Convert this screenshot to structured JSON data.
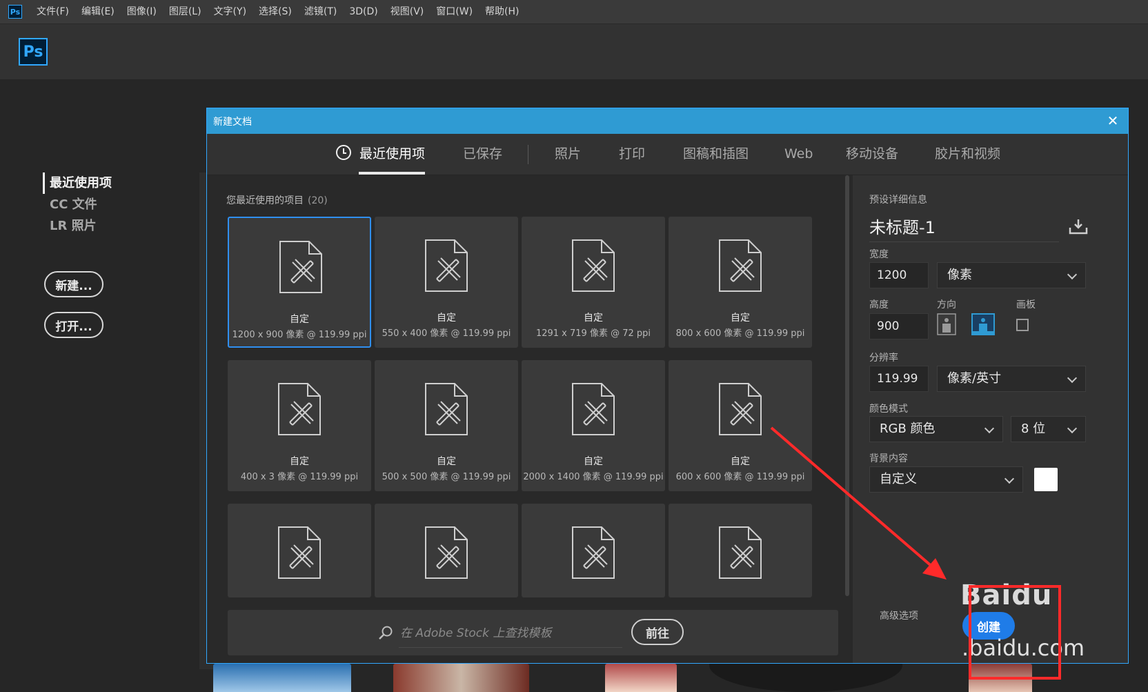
{
  "menubar": {
    "app_icon": "Ps",
    "items": [
      "文件(F)",
      "编辑(E)",
      "图像(I)",
      "图层(L)",
      "文字(Y)",
      "选择(S)",
      "滤镜(T)",
      "3D(D)",
      "视图(V)",
      "窗口(W)",
      "帮助(H)"
    ]
  },
  "appbar": {
    "logo": "Ps"
  },
  "home": {
    "nav": [
      "最近使用项",
      "CC 文件",
      "LR 照片"
    ],
    "new_button": "新建...",
    "open_button": "打开..."
  },
  "dialog": {
    "title": "新建文档",
    "tabs": [
      "最近使用项",
      "已保存",
      "照片",
      "打印",
      "图稿和插图",
      "Web",
      "移动设备",
      "胶片和视频"
    ],
    "recent_heading": "您最近使用的项目",
    "recent_count": "(20)",
    "cards": [
      {
        "name": "自定",
        "meta": "1200 x 900 像素 @ 119.99 ppi"
      },
      {
        "name": "自定",
        "meta": "550 x 400 像素 @ 119.99 ppi"
      },
      {
        "name": "自定",
        "meta": "1291 x 719 像素 @ 72 ppi"
      },
      {
        "name": "自定",
        "meta": "800 x 600 像素 @ 119.99 ppi"
      },
      {
        "name": "自定",
        "meta": "400 x 3 像素 @ 119.99 ppi"
      },
      {
        "name": "自定",
        "meta": "500 x 500 像素 @ 119.99 ppi"
      },
      {
        "name": "自定",
        "meta": "2000 x 1400 像素 @ 119.99 ppi"
      },
      {
        "name": "自定",
        "meta": "600 x 600 像素 @ 119.99 ppi"
      },
      {
        "name": "",
        "meta": ""
      },
      {
        "name": "",
        "meta": ""
      },
      {
        "name": "",
        "meta": ""
      },
      {
        "name": "",
        "meta": ""
      }
    ],
    "stock_placeholder": "在 Adobe Stock 上查找模板",
    "go_button": "前往",
    "preset": {
      "heading": "预设详细信息",
      "doc_name": "未标题-1",
      "width_label": "宽度",
      "width_value": "1200",
      "width_unit": "像素",
      "height_label": "高度",
      "height_value": "900",
      "orientation_label": "方向",
      "artboard_label": "画板",
      "resolution_label": "分辨率",
      "resolution_value": "119.99",
      "resolution_unit": "像素/英寸",
      "color_mode_label": "颜色模式",
      "color_mode": "RGB 颜色",
      "bit_depth": "8 位",
      "background_label": "背景内容",
      "background": "自定义",
      "advanced": "高级选项",
      "create_button": "创建"
    }
  },
  "watermark": {
    "text": "Baidu",
    "sub": ".baidu.com"
  },
  "colors": {
    "accent": "#2f9bd3",
    "create": "#1f7ce8",
    "highlight": "#ff2a2a"
  }
}
